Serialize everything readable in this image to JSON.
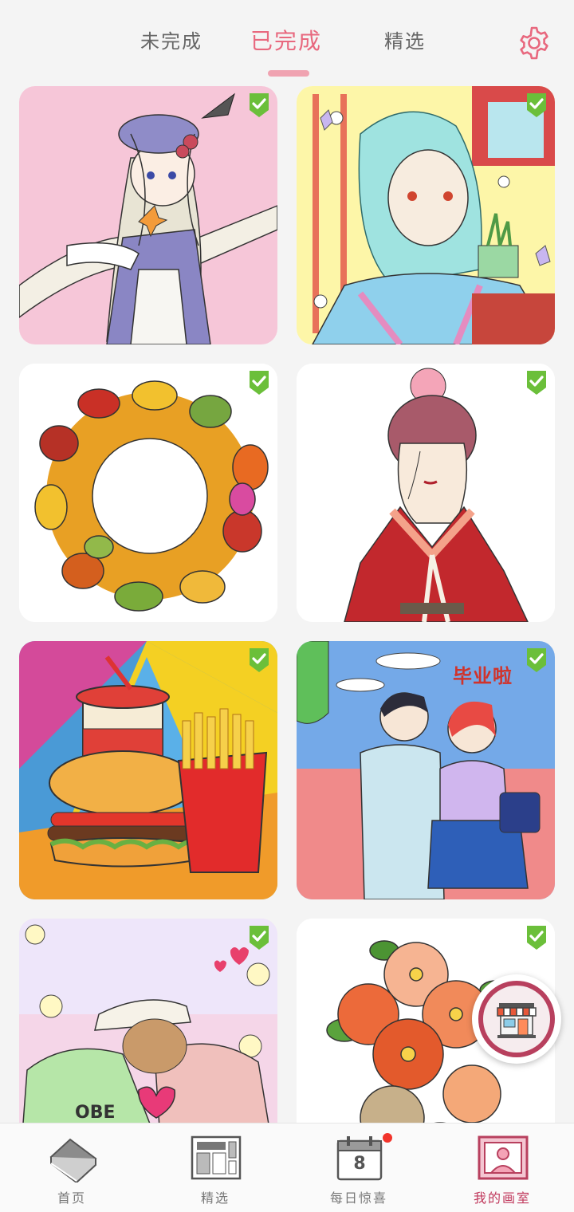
{
  "top_tabs": [
    {
      "label": "未完成",
      "active": false
    },
    {
      "label": "已完成",
      "active": true
    },
    {
      "label": "精选",
      "active": false
    }
  ],
  "accent_color": "#e8687e",
  "check_color": "#6bbf3a",
  "gallery": {
    "items": [
      {
        "subject": "anime girl with feathered hat",
        "completed": true
      },
      {
        "subject": "anime girl with teal hair and flowers",
        "completed": true
      },
      {
        "subject": "autumn leaf wreath",
        "completed": true
      },
      {
        "subject": "girl in red kimono",
        "completed": true
      },
      {
        "subject": "burger fries and drink",
        "completed": true
      },
      {
        "subject": "graduation couple",
        "completed": true,
        "caption": "毕业啦"
      },
      {
        "subject": "couple with cap and hearts",
        "completed": true
      },
      {
        "subject": "flower bouquet",
        "completed": true
      }
    ]
  },
  "floating_button": {
    "icon": "store-icon"
  },
  "bottom_nav": [
    {
      "label": "首页",
      "icon": "book-icon",
      "active": false
    },
    {
      "label": "精选",
      "icon": "gallery-grid-icon",
      "active": false
    },
    {
      "label": "每日惊喜",
      "icon": "calendar-icon",
      "active": false,
      "calendar_day": "8",
      "has_badge": true
    },
    {
      "label": "我的画室",
      "icon": "portrait-frame-icon",
      "active": true
    }
  ]
}
